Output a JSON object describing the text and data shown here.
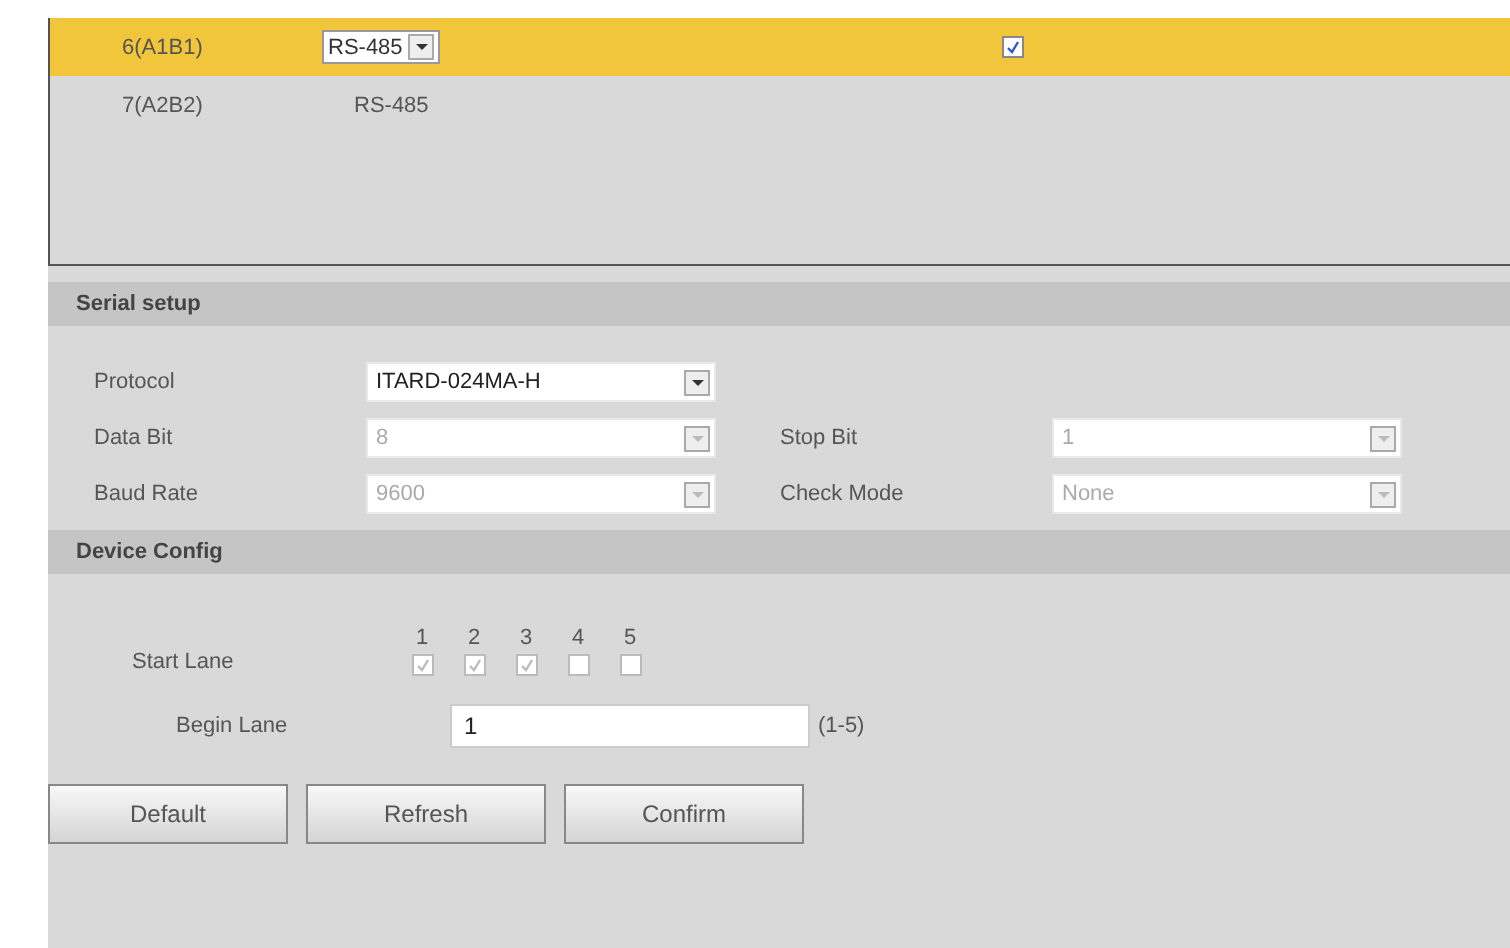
{
  "ports": [
    {
      "name": "6(A1B1)",
      "type": "RS-485",
      "selected": true,
      "checked": true
    },
    {
      "name": "7(A2B2)",
      "type": "RS-485",
      "selected": false,
      "checked": false
    }
  ],
  "serial_setup": {
    "title": "Serial setup",
    "fields": [
      {
        "label": "Protocol",
        "value": "ITARD-024MA-H",
        "disabled": false
      },
      {
        "label": "Data Bit",
        "value": "8",
        "disabled": true
      },
      {
        "label": "Stop Bit",
        "value": "1",
        "disabled": true
      },
      {
        "label": "Baud Rate",
        "value": "9600",
        "disabled": true
      },
      {
        "label": "Check Mode",
        "value": "None",
        "disabled": true
      }
    ]
  },
  "device_config": {
    "title": "Device Config",
    "start_lane": {
      "label": "Start Lane",
      "lanes": [
        {
          "label": "1",
          "checked": true
        },
        {
          "label": "2",
          "checked": true
        },
        {
          "label": "3",
          "checked": true
        },
        {
          "label": "4",
          "checked": false
        },
        {
          "label": "5",
          "checked": false
        }
      ]
    },
    "begin_lane": {
      "label": "Begin Lane",
      "value": "1",
      "hint": "(1-5)"
    }
  },
  "buttons": [
    "Default",
    "Refresh",
    "Confirm"
  ]
}
